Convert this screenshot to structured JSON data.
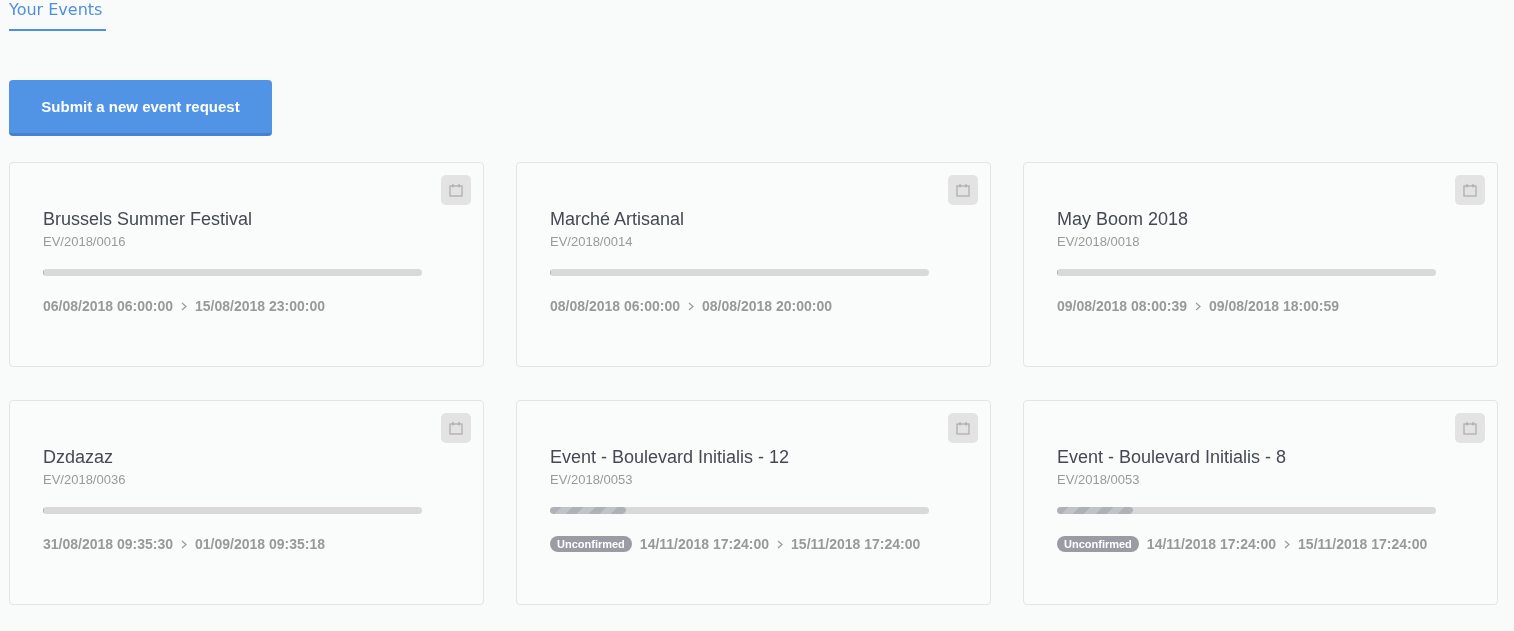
{
  "heading": "Your Events",
  "submit_button": "Submit a new event request",
  "events": [
    {
      "title": "Brussels Summer Festival",
      "code": "EV/2018/0016",
      "level": 0,
      "start": "06/08/2018 06:00:00",
      "end": "15/08/2018 23:00:00"
    },
    {
      "title": "Marché Artisanal",
      "code": "EV/2018/0014",
      "level": 0,
      "start": "08/08/2018 06:00:00",
      "end": "08/08/2018 20:00:00"
    },
    {
      "title": "May Boom 2018",
      "code": "EV/2018/0018",
      "level": 0,
      "start": "09/08/2018 08:00:39",
      "end": "09/08/2018 18:00:59"
    },
    {
      "title": "Dzdazaz",
      "code": "EV/2018/0036",
      "level": 0,
      "start": "31/08/2018 09:35:30",
      "end": "01/09/2018 09:35:18"
    },
    {
      "title": "Event - Boulevard Initialis - 12",
      "code": "EV/2018/0053",
      "level": 0.2,
      "status": "Unconfirmed",
      "start": "14/11/2018 17:24:00",
      "end": "15/11/2018 17:24:00"
    },
    {
      "title": "Event - Boulevard Initialis - 8",
      "code": "EV/2018/0053",
      "level": 0.2,
      "status": "Unconfirmed",
      "start": "14/11/2018 17:24:00",
      "end": "15/11/2018 17:24:00"
    }
  ]
}
